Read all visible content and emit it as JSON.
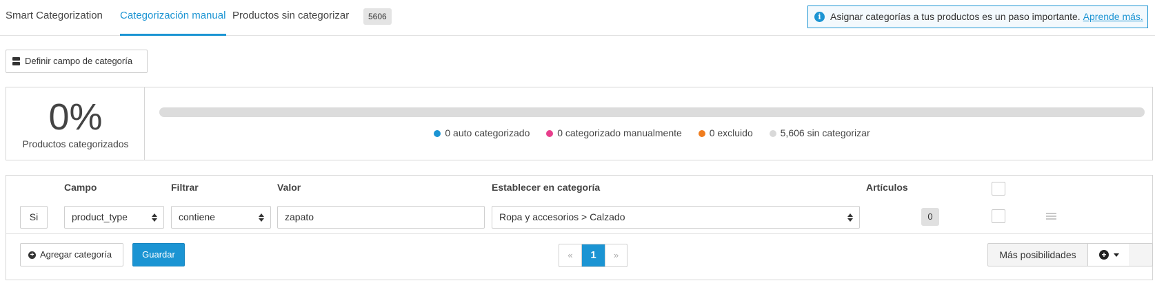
{
  "tabs": [
    {
      "label": "Smart Categorization",
      "active": false
    },
    {
      "label": "Categorización manual",
      "active": true
    },
    {
      "label": "Productos sin categorizar",
      "active": false,
      "badge": "5606"
    }
  ],
  "info": {
    "icon": "info-icon",
    "icon_glyph": "i",
    "text": "Asignar categorías a tus productos es un paso importante.",
    "link": "Aprende más."
  },
  "define_button": {
    "label": "Definir campo de categoría",
    "icon": "database-icon"
  },
  "stats": {
    "percent": "0%",
    "label": "Productos categorizados",
    "progress_fraction": 0,
    "legend": [
      {
        "label": "0 auto categorizado",
        "color": "#1b94d3"
      },
      {
        "label": "0 categorizado manualmente",
        "color": "#e83e8c"
      },
      {
        "label": "0 excluido",
        "color": "#f07d1f"
      },
      {
        "label": "5,606 sin categorizar",
        "color": "#d9d9d9"
      }
    ]
  },
  "rules": {
    "headers": {
      "campo": "Campo",
      "filtrar": "Filtrar",
      "valor": "Valor",
      "categoria": "Establecer en categoría",
      "articulos": "Artículos"
    },
    "rows": [
      {
        "condition": "Si",
        "field": "product_type",
        "filter": "contiene",
        "value": "zapato",
        "category": "Ropa y accesorios > Calzado",
        "count": "0"
      }
    ],
    "add_label": "Agregar categoría",
    "add_icon_glyph": "+",
    "save_label": "Guardar",
    "pagination": {
      "prev": "«",
      "current": "1",
      "next": "»"
    },
    "more_label": "Más posibilidades",
    "more_icon_glyph": "+"
  },
  "colors": {
    "accent": "#1b94d3"
  }
}
